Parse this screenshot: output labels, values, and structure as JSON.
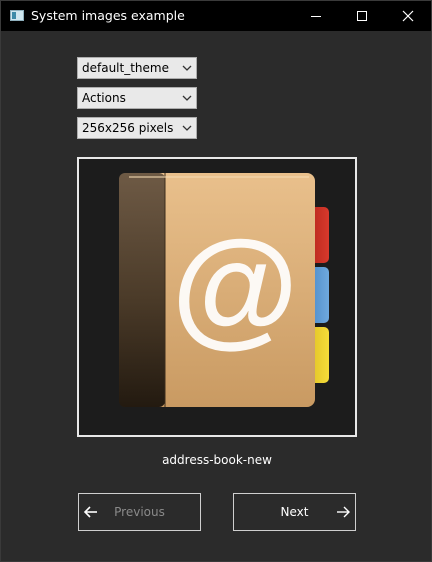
{
  "window": {
    "title": "System images example"
  },
  "controls": {
    "theme_select": {
      "value": "default_theme"
    },
    "category_select": {
      "value": "Actions"
    },
    "size_select": {
      "value": "256x256 pixels"
    }
  },
  "preview": {
    "icon_name": "address-book-new",
    "glyph": "@"
  },
  "navigation": {
    "previous_label": "Previous",
    "next_label": "Next"
  },
  "colors": {
    "background": "#2b2b2b",
    "titlebar": "#000000",
    "book_cover": "#e3b883",
    "tab_red": "#c9261c",
    "tab_blue": "#5d9bd3",
    "tab_yellow": "#f1d22c"
  }
}
